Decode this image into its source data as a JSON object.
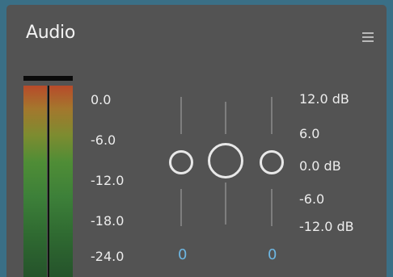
{
  "panel": {
    "title": "Audio",
    "menu_icon": "hamburger-menu-icon"
  },
  "meter": {
    "scale": [
      "0.0",
      "-6.0",
      "-12.0",
      "-18.0",
      "-24.0"
    ],
    "colors": {
      "top": "#b84a2a",
      "mid": "#4f8d36",
      "bottom": "#25532b",
      "peak": "#0b0b0b"
    }
  },
  "mixer": {
    "left_slider": {
      "value": "0",
      "knob_icon": "pan-knob-icon"
    },
    "center_slider": {
      "knob_icon": "volume-knob-icon"
    },
    "right_slider": {
      "value": "0",
      "knob_icon": "balance-knob-icon"
    },
    "db_scale": [
      "12.0 dB",
      "6.0",
      "0.0 dB",
      "-6.0",
      "-12.0 dB"
    ],
    "value_color": "#6db7e3"
  }
}
